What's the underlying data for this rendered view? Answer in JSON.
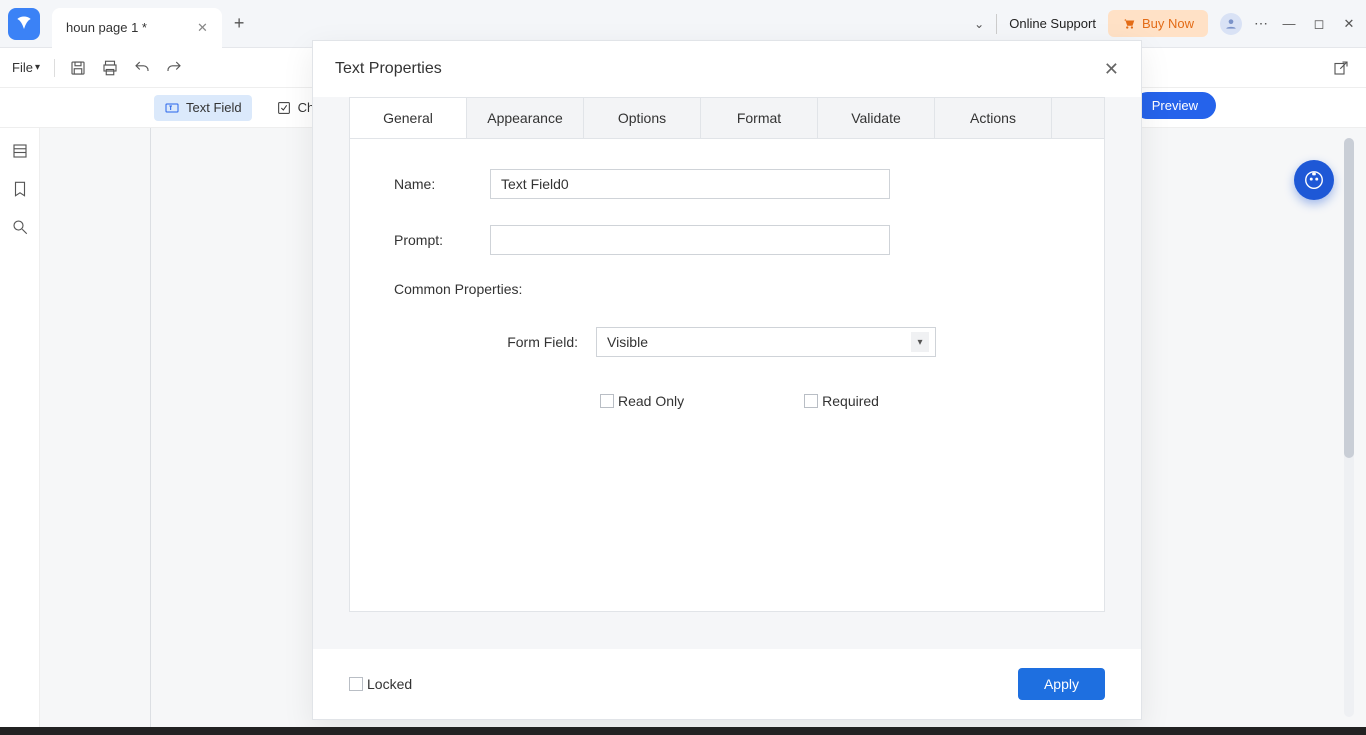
{
  "titlebar": {
    "tab_name": "houn page 1 *",
    "online_support": "Online Support",
    "buy_now": "Buy Now"
  },
  "menubar": {
    "file": "File"
  },
  "formbar": {
    "text_field": "Text Field",
    "check_box_prefix": "Chec",
    "preview": "Preview"
  },
  "modal": {
    "title": "Text Properties",
    "tabs": {
      "general": "General",
      "appearance": "Appearance",
      "options": "Options",
      "format": "Format",
      "validate": "Validate",
      "actions": "Actions"
    },
    "name_label": "Name:",
    "name_value": "Text Field0",
    "prompt_label": "Prompt:",
    "prompt_value": "",
    "common_props": "Common Properties:",
    "form_field_label": "Form Field:",
    "form_field_value": "Visible",
    "read_only": "Read Only",
    "required": "Required",
    "locked": "Locked",
    "apply": "Apply"
  }
}
